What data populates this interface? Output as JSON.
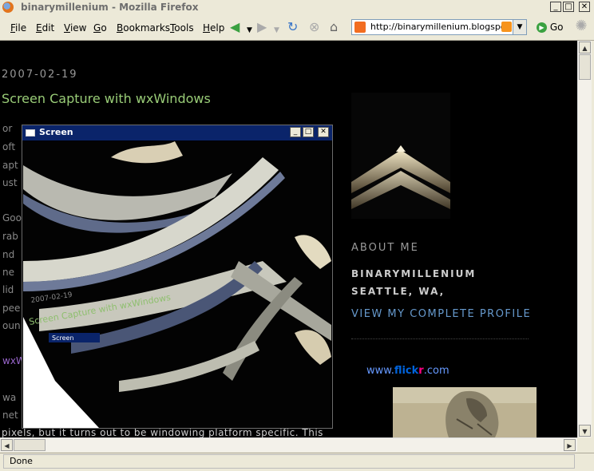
{
  "window": {
    "title": "binarymillenium - Mozilla Firefox"
  },
  "menu": [
    "File",
    "Edit",
    "View",
    "Go",
    "Bookmarks",
    "Tools",
    "Help"
  ],
  "nav": {
    "url": "http://binarymillenium.blogspot.com/",
    "go_label": "Go"
  },
  "post": {
    "date": "2007-02-19",
    "title": "Screen Capture with wxWindows",
    "fragments": [
      "or",
      "oft",
      "apt",
      "ust",
      "Goo",
      "rab",
      "nd",
      "ne",
      "lid",
      "pee",
      "oun"
    ],
    "link_fragment": "wxW",
    "fragments2": [
      "wa",
      "net"
    ],
    "partial_line": "pixels, but it turns out to be windowing platform specific. This"
  },
  "sidebar": {
    "about_heading": "ABOUT ME",
    "name": "BINARYMILLENIUM",
    "location": "SEATTLE, WA,",
    "profile_link": "VIEW MY COMPLETE PROFILE",
    "flickr": {
      "www": "www.",
      "fl1": "flick",
      "fl2": "r",
      "com": ".com"
    }
  },
  "capture_window": {
    "title": "Screen"
  },
  "status": {
    "text": "Done"
  }
}
